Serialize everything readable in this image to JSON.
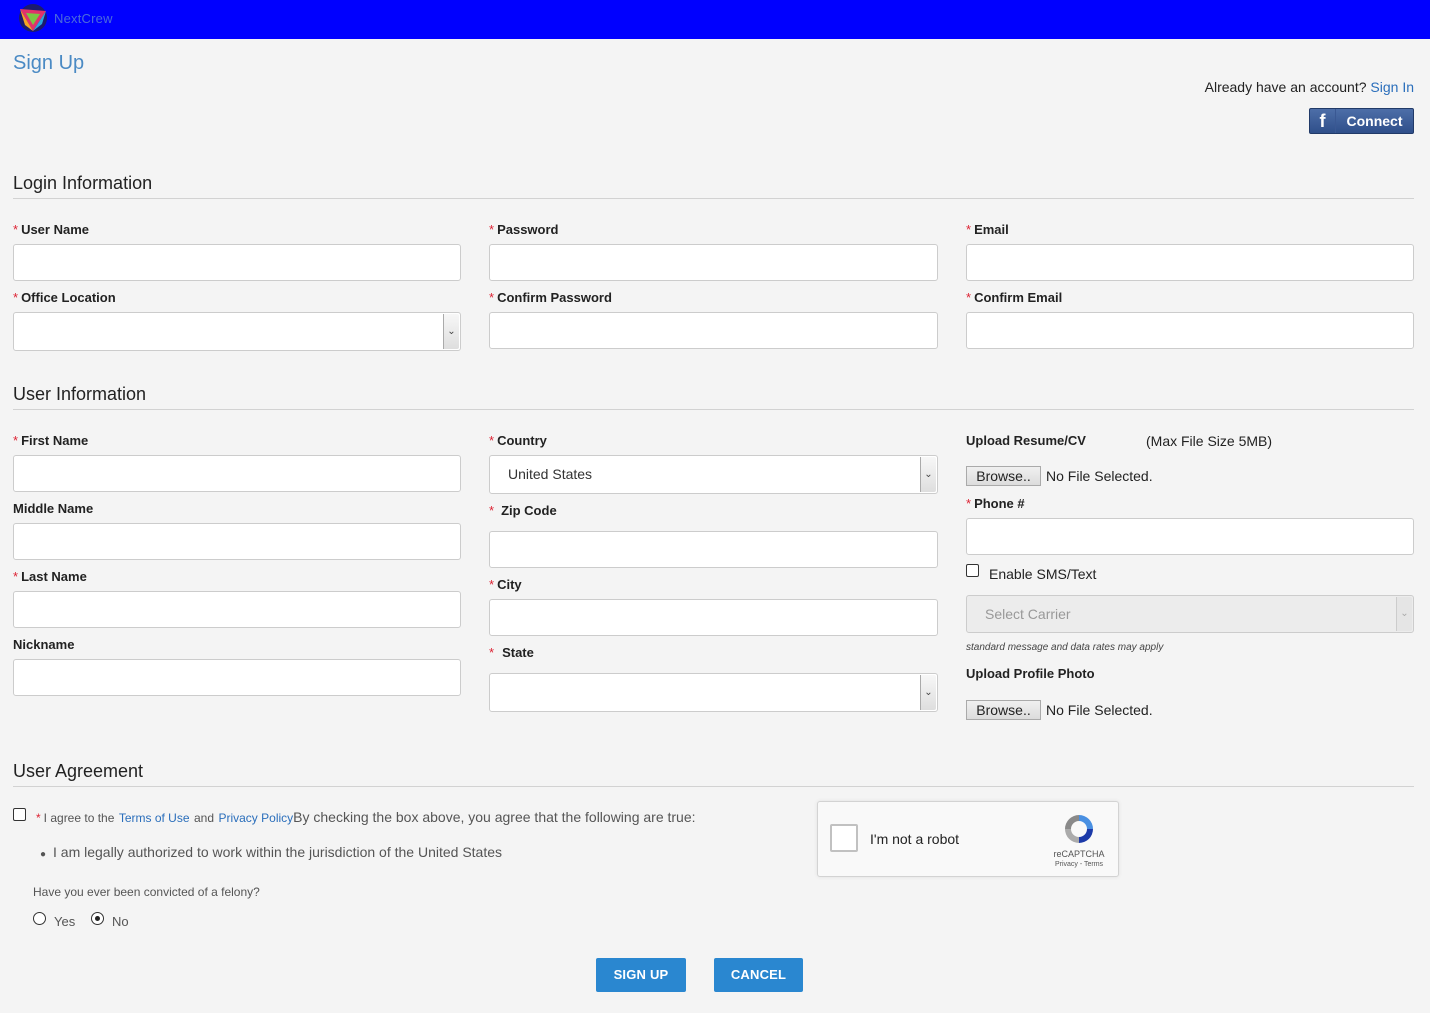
{
  "header": {
    "logo_text": "NextCrew",
    "brand_color": "#0000ff"
  },
  "page": {
    "title": "Sign Up",
    "already_text": "Already have an account?",
    "sign_in_link": "Sign In",
    "facebook_connect": "Connect"
  },
  "sections": {
    "login": "Login Information",
    "user": "User Information",
    "agreement": "User Agreement"
  },
  "login": {
    "user_name_label": "User Name",
    "password_label": "Password",
    "email_label": "Email",
    "office_location_label": "Office Location",
    "confirm_password_label": "Confirm Password",
    "confirm_email_label": "Confirm Email",
    "office_location_value": ""
  },
  "user": {
    "first_name_label": "First Name",
    "middle_name_label": "Middle Name",
    "last_name_label": "Last Name",
    "nickname_label": "Nickname",
    "country_label": "Country",
    "country_value": "United States",
    "zip_label": "Zip Code",
    "city_label": "City",
    "state_label": "State",
    "state_value": "",
    "resume_label": "Upload Resume/CV",
    "resume_max": "(Max File Size 5MB)",
    "browse_label": "Browse..",
    "no_file": "No File Selected.",
    "phone_label": "Phone #",
    "sms_label": "Enable SMS/Text",
    "carrier_placeholder": "Select Carrier",
    "sms_note": "standard message and data rates may apply",
    "photo_label": "Upload Profile Photo"
  },
  "agreement": {
    "agree_prefix": "I agree to the",
    "terms_link": "Terms of Use",
    "and": "and",
    "privacy_link": "Privacy Policy",
    "agree_suffix": "By checking the box above, you agree that the following are true:",
    "bullet": "I am legally authorized to work within the jurisdiction of the United States",
    "felony_question": "Have you ever been convicted of a felony?",
    "yes_label": "Yes",
    "no_label": "No",
    "felony_answer": "No"
  },
  "captcha": {
    "text": "I'm not a robot",
    "brand": "reCAPTCHA",
    "terms": "Privacy - Terms"
  },
  "actions": {
    "sign_up": "SIGN UP",
    "cancel": "CANCEL"
  }
}
